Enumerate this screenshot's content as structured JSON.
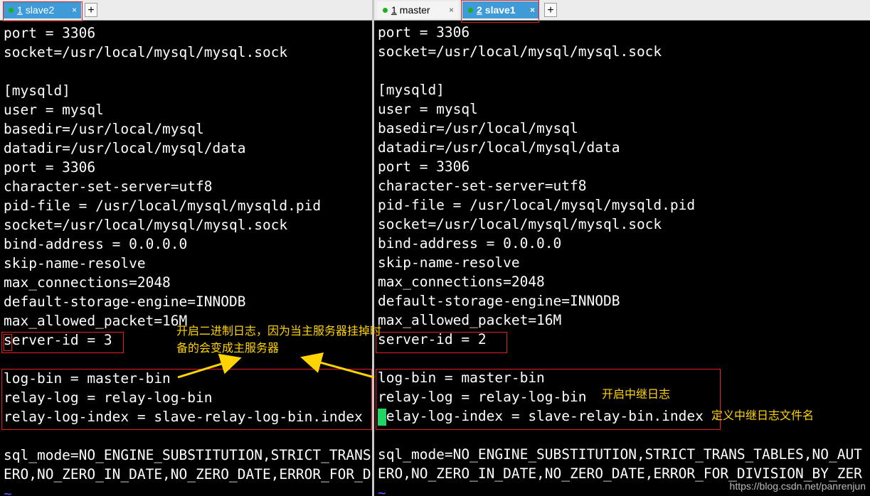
{
  "left_pane": {
    "tabs": [
      {
        "num": "1",
        "label": "slave2",
        "close": "×"
      }
    ],
    "add_tab": "+",
    "lines": [
      "port = 3306",
      "socket=/usr/local/mysql/mysql.sock",
      "",
      "[mysqld]",
      "user = mysql",
      "basedir=/usr/local/mysql",
      "datadir=/usr/local/mysql/data",
      "port = 3306",
      "character-set-server=utf8",
      "pid-file = /usr/local/mysql/mysqld.pid",
      "socket=/usr/local/mysql/mysql.sock",
      "bind-address = 0.0.0.0",
      "skip-name-resolve",
      "max_connections=2048",
      "default-storage-engine=INNODB",
      "max_allowed_packet=16M",
      "server-id = 3",
      "",
      "log-bin = master-bin",
      "relay-log = relay-log-bin",
      "relay-log-index = slave-relay-log-bin.index",
      "",
      "sql_mode=NO_ENGINE_SUBSTITUTION,STRICT_TRANS",
      "ERO,NO_ZERO_IN_DATE,NO_ZERO_DATE,ERROR_FOR_D",
      "~"
    ]
  },
  "right_pane": {
    "tabs": [
      {
        "num": "1",
        "label": "master",
        "close": "×"
      },
      {
        "num": "2",
        "label": "slave1",
        "close": "×"
      }
    ],
    "add_tab": "+",
    "lines": [
      "port = 3306",
      "socket=/usr/local/mysql/mysql.sock",
      "",
      "[mysqld]",
      "user = mysql",
      "basedir=/usr/local/mysql",
      "datadir=/usr/local/mysql/data",
      "port = 3306",
      "character-set-server=utf8",
      "pid-file = /usr/local/mysql/mysqld.pid",
      "socket=/usr/local/mysql/mysql.sock",
      "bind-address = 0.0.0.0",
      "skip-name-resolve",
      "max_connections=2048",
      "default-storage-engine=INNODB",
      "max_allowed_packet=16M",
      "server-id = 2",
      "",
      "log-bin = master-bin",
      "relay-log = relay-log-bin",
      "relay-log-index = slave-relay-bin.index",
      "",
      "sql_mode=NO_ENGINE_SUBSTITUTION,STRICT_TRANS_TABLES,NO_AUT",
      "ERO,NO_ZERO_IN_DATE,NO_ZERO_DATE,ERROR_FOR_DIVISION_BY_ZER",
      "~"
    ]
  },
  "annotations": {
    "binlog_line1": "开启二进制日志，因为当主服务器挂掉时",
    "binlog_line2": "备的会变成主服务器",
    "relay_log": "开启中继日志",
    "relay_index": "定义中继日志文件名"
  },
  "watermark": "https://blog.csdn.net/panrenjun",
  "colors": {
    "background": "#000000",
    "text": "#ffffff",
    "annotation": "#ffd400",
    "highlight_box": "#e02020",
    "cursor": "#1ed760",
    "active_tab": "#3f9ad8"
  }
}
